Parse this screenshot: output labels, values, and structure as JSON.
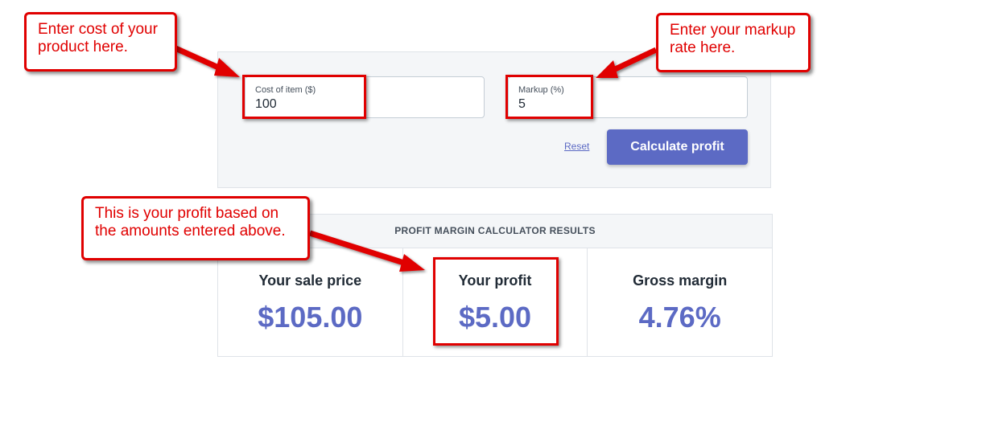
{
  "form": {
    "cost_label": "Cost of item ($)",
    "cost_value": "100",
    "markup_label": "Markup (%)",
    "markup_value": "5",
    "reset_label": "Reset",
    "calculate_label": "Calculate profit"
  },
  "results": {
    "header": "PROFIT MARGIN CALCULATOR RESULTS",
    "sale_price_title": "Your sale price",
    "sale_price_value": "$105.00",
    "profit_title": "Your profit",
    "profit_value": "$5.00",
    "margin_title": "Gross margin",
    "margin_value": "4.76%"
  },
  "annotations": {
    "cost_callout": "Enter cost of your product here.",
    "markup_callout": "Enter your markup rate here.",
    "profit_callout": "This is your profit based on the amounts entered above."
  },
  "colors": {
    "accent": "#5c6ac4",
    "annotation": "#e00000"
  }
}
